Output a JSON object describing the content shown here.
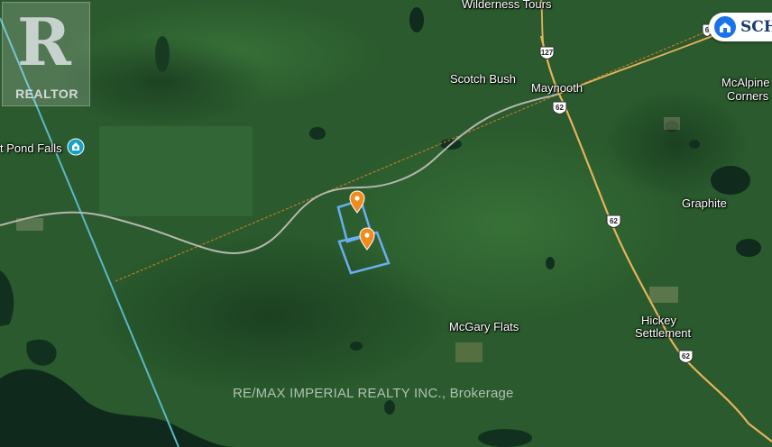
{
  "map": {
    "logo": {
      "letter": "R",
      "text": "REALTOR"
    },
    "school_badge": {
      "text": "SCH"
    },
    "watermark": "RE/MAX IMPERIAL REALTY INC., Brokerage",
    "place_labels": [
      {
        "text": "Wilderness Tours"
      },
      {
        "text": "Scotch Bush"
      },
      {
        "text": "Maynooth"
      },
      {
        "text": "McAlpine"
      },
      {
        "text": "Corners"
      },
      {
        "text": "t Pond Falls"
      },
      {
        "text": "Graphite"
      },
      {
        "text": "McGary Flats"
      },
      {
        "text": "Hickey"
      },
      {
        "text": "Settlement"
      }
    ],
    "highway_shields": [
      {
        "number": "127"
      },
      {
        "number": "62"
      },
      {
        "number": "62"
      },
      {
        "number": "62"
      },
      {
        "number": "6"
      }
    ],
    "pins": [
      {
        "label": "property-marker-north"
      },
      {
        "label": "property-marker-south"
      }
    ],
    "colors": {
      "forest": "#2c5e2f",
      "property_outline": "#6aaef0",
      "pin": "#f08c1e",
      "highway": "#e6b35a",
      "boundary_line": "#5ab8c8",
      "road": "#b7b7b0",
      "water": "#0f2a1c"
    }
  }
}
